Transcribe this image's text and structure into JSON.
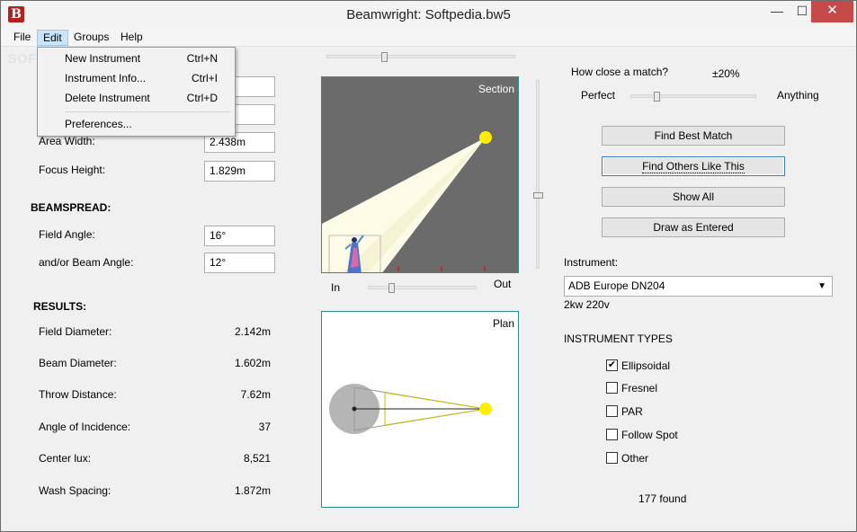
{
  "window": {
    "title": "Beamwright: Softpedia.bw5",
    "icon": "B",
    "watermark": "SOFTPEDIA"
  },
  "titlebar_buttons": {
    "minimize": "—",
    "maximize": "☐",
    "close": "✕"
  },
  "menubar": [
    "File",
    "Edit",
    "Groups",
    "Help"
  ],
  "edit_menu": {
    "items": [
      {
        "label": "New Instrument",
        "shortcut": "Ctrl+N"
      },
      {
        "label": "Instrument Info...",
        "shortcut": "Ctrl+I"
      },
      {
        "label": "Delete Instrument",
        "shortcut": "Ctrl+D"
      },
      {
        "label": "Preferences...",
        "shortcut": ""
      }
    ]
  },
  "inputs": {
    "field1_value": "m",
    "field2_value": "m",
    "area_width_label": "Area Width:",
    "area_width_value": "2.438m",
    "focus_height_label": "Focus Height:",
    "focus_height_value": "1.829m"
  },
  "beamspread": {
    "heading": "BEAMSPREAD:",
    "field_angle_label": "Field Angle:",
    "field_angle_value": "16°",
    "beam_angle_label": "and/or Beam Angle:",
    "beam_angle_value": "12°"
  },
  "results": {
    "heading": "RESULTS:",
    "rows": [
      {
        "label": "Field Diameter:",
        "value": "2.142m"
      },
      {
        "label": "Beam Diameter:",
        "value": "1.602m"
      },
      {
        "label": "Throw Distance:",
        "value": "7.62m"
      },
      {
        "label": "Angle of Incidence:",
        "value": "37"
      },
      {
        "label": "Center lux:",
        "value": "8,521"
      },
      {
        "label": "Wash Spacing:",
        "value": "1.872m"
      }
    ]
  },
  "section_panel": {
    "label": "Section",
    "zoom_in": "In",
    "zoom_out": "Out",
    "zoom_level": 0.2,
    "top_slider_level": 0.3,
    "vertical_slider_level": 0.62
  },
  "plan_panel": {
    "label": "Plan"
  },
  "match": {
    "question": "How close a match?",
    "tolerance": "±20%",
    "left_label": "Perfect",
    "right_label": "Anything",
    "level": 0.2
  },
  "buttons": {
    "find_best": "Find Best Match",
    "find_others": "Find Others Like This",
    "show_all": "Show All",
    "draw_entered": "Draw as Entered"
  },
  "instrument": {
    "label": "Instrument:",
    "selected": "ADB Europe DN204",
    "spec": "2kw 220v"
  },
  "instrument_types": {
    "heading": "INSTRUMENT TYPES",
    "items": [
      {
        "label": "Ellipsoidal",
        "checked": "✔"
      },
      {
        "label": "Fresnel",
        "checked": ""
      },
      {
        "label": "PAR",
        "checked": ""
      },
      {
        "label": "Follow Spot",
        "checked": ""
      },
      {
        "label": "Other",
        "checked": ""
      }
    ]
  },
  "found_count": "177 found",
  "colors": {
    "beam": "#fbfbe6",
    "lamp": "#ffee00",
    "section_bg": "#6b6b6b",
    "panel_border": "#2f8a8a",
    "close_btn": "#c74a4a"
  }
}
